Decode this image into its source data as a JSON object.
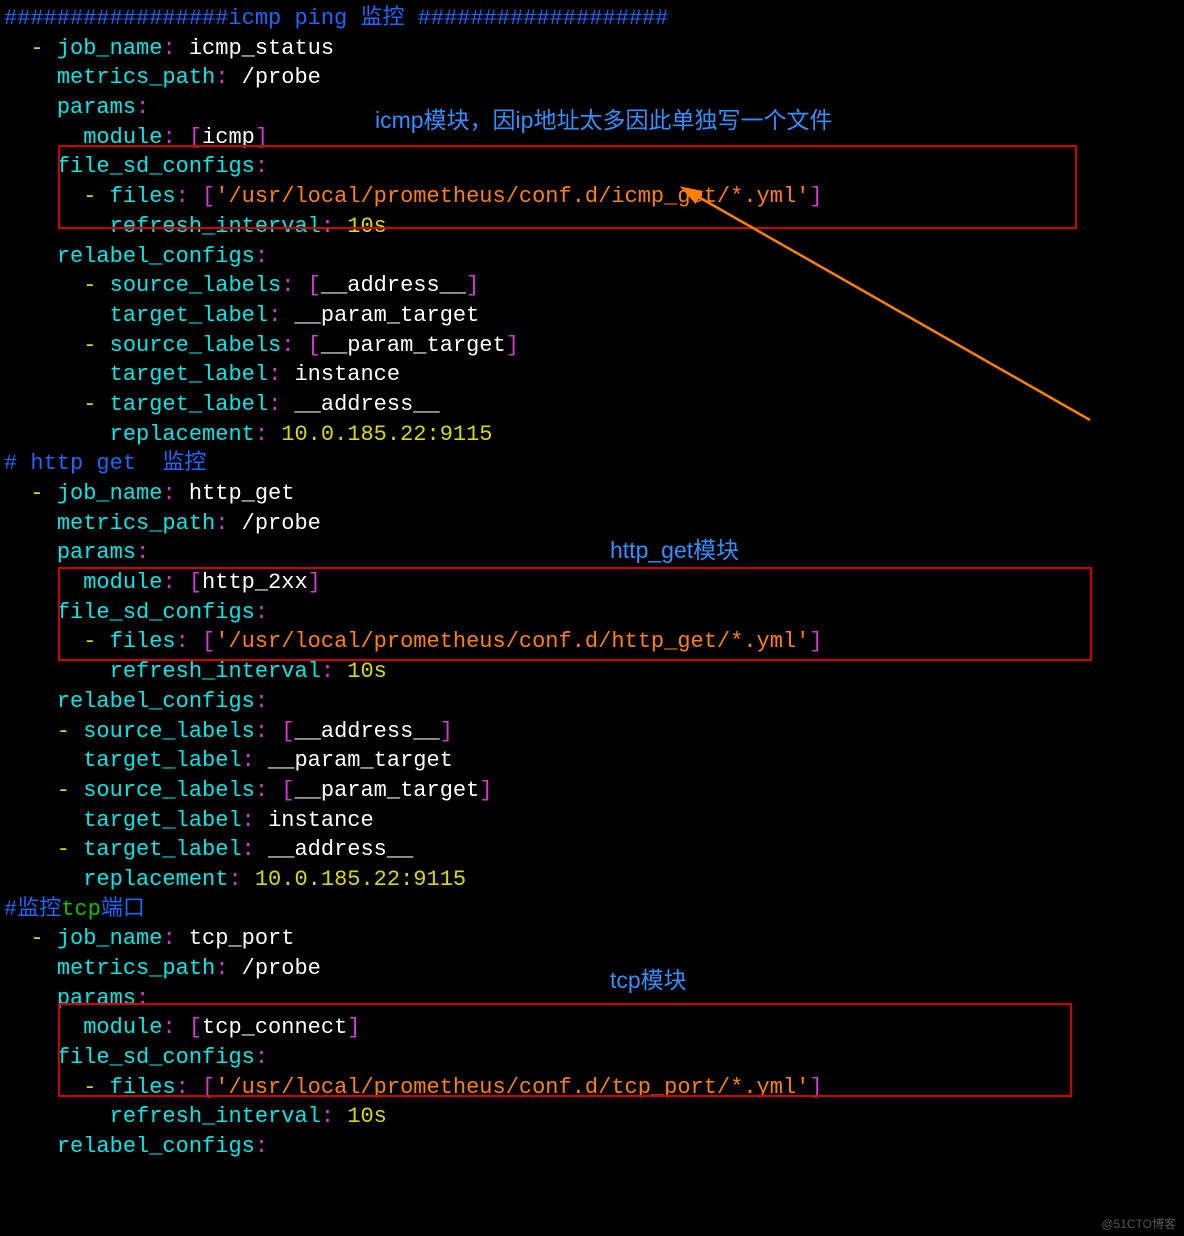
{
  "comments": {
    "icmp_header": "#################icmp ping 监控 ###################",
    "http_header": "# http get  监控",
    "tcp_header_pre": "#监控",
    "tcp_header_mid": "tcp",
    "tcp_header_post": "端口"
  },
  "keys": {
    "job_name": "job_name",
    "metrics_path": "metrics_path",
    "params": "params",
    "module": "module",
    "file_sd_configs": "file_sd_configs",
    "files": "files",
    "refresh_interval": "refresh_interval",
    "relabel_configs": "relabel_configs",
    "source_labels": "source_labels",
    "target_label": "target_label",
    "replacement": "replacement"
  },
  "jobs": {
    "icmp": {
      "name": "icmp_status",
      "path": "/probe",
      "module": "icmp",
      "files": "'/usr/local/prometheus/conf.d/icmp_get/*.yml'",
      "refresh": "10s",
      "relabel": {
        "sl_addr": "__address__",
        "tl_param": "__param_target",
        "sl_param": "__param_target",
        "tl_inst": "instance",
        "tl_addr": "__address__",
        "repl": "10.0.185.22:9115"
      }
    },
    "http": {
      "name": "http_get",
      "path": "/probe",
      "module": "http_2xx",
      "files": "'/usr/local/prometheus/conf.d/http_get/*.yml'",
      "refresh": "10s",
      "relabel": {
        "sl_addr": "__address__",
        "tl_param": "__param_target",
        "sl_param": "__param_target",
        "tl_inst": "instance",
        "tl_addr": "__address__",
        "repl": "10.0.185.22:9115"
      }
    },
    "tcp": {
      "name": "tcp_port",
      "path": "/probe",
      "module": "tcp_connect",
      "files": "'/usr/local/prometheus/conf.d/tcp_port/*.yml'",
      "refresh": "10s"
    }
  },
  "annotations": {
    "icmp": "icmp模块，因ip地址太多因此单独写一个文件",
    "http": "http_get模块",
    "tcp": "tcp模块"
  },
  "watermark": "@51CTO博客"
}
